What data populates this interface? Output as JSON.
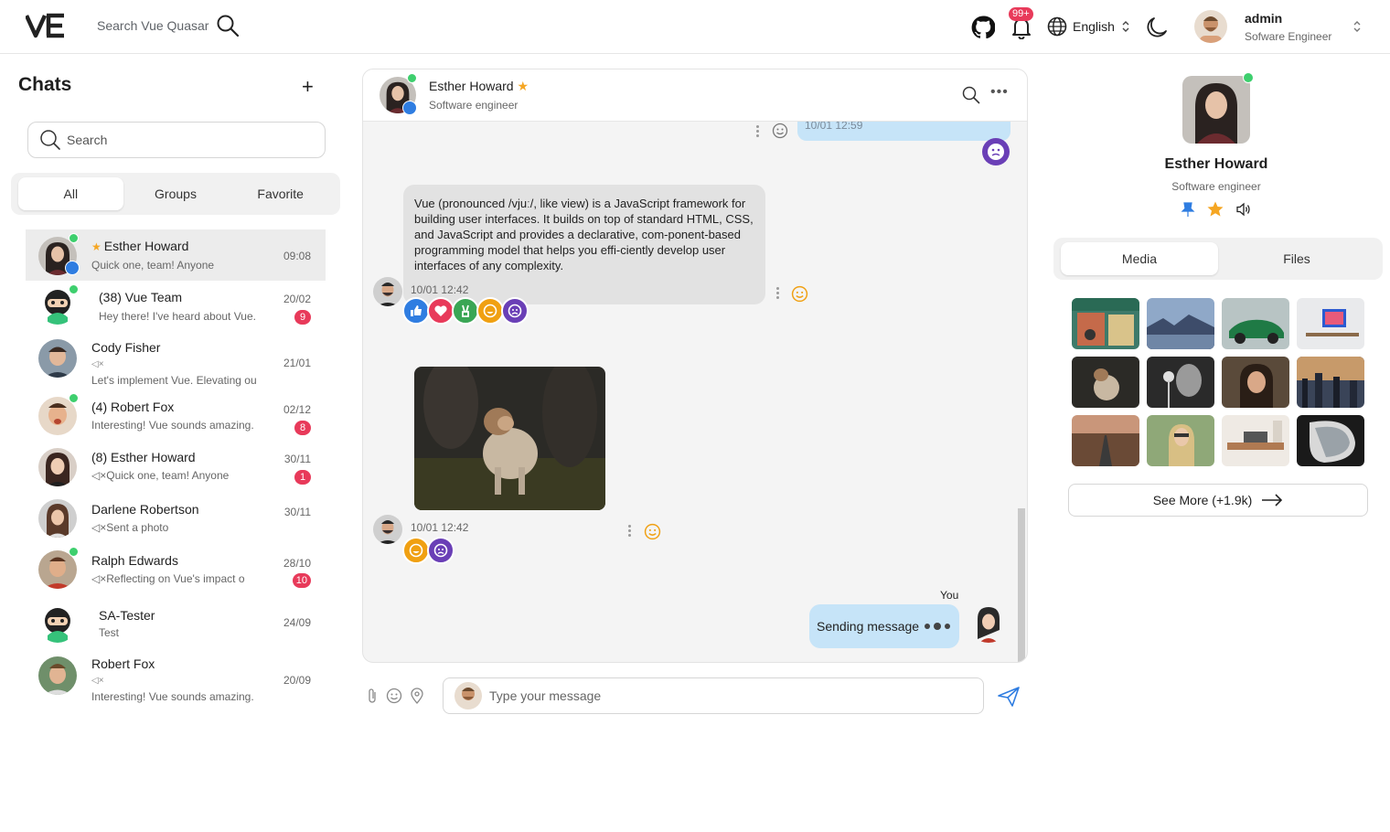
{
  "header": {
    "logo_text": "VE",
    "search_label": "Search Vue Quasar",
    "notifications_badge": "99+",
    "language": "English",
    "user_name": "admin",
    "user_role": "Sofware Engineer"
  },
  "sidebar": {
    "title": "Chats",
    "search_placeholder": "Search",
    "filters": [
      "All",
      "Groups",
      "Favorite"
    ],
    "active_filter": "All",
    "chats": [
      {
        "name": "Esther Howard",
        "favorite": true,
        "last": "Quick one, team! Anyone",
        "time": "09:08",
        "online": true,
        "pinned": true,
        "active": true
      },
      {
        "name": "(38) Vue Team",
        "last": "Hey there! I've heard about Vue.",
        "time": "20/02",
        "badge": "9",
        "online": true
      },
      {
        "name": "Cody Fisher",
        "muted": "◁×",
        "last": "Let's implement Vue. Elevating ou",
        "time": "21/01"
      },
      {
        "name": "(4) Robert Fox",
        "last": "Interesting! Vue sounds amazing.",
        "time": "02/12",
        "badge": "8",
        "online": true
      },
      {
        "name": "(8) Esther Howard",
        "last": "◁×Quick one, team! Anyone",
        "time": "30/11",
        "badge": "1"
      },
      {
        "name": "Darlene Robertson",
        "last": "◁×Sent a photo",
        "time": "30/11"
      },
      {
        "name": "Ralph Edwards",
        "last": "◁×Reflecting on Vue's impact o",
        "time": "28/10",
        "badge": "10",
        "online": true
      },
      {
        "name": "SA-Tester",
        "last": "Test",
        "time": "24/09"
      },
      {
        "name": "Robert Fox",
        "muted": "◁×",
        "last": "Interesting! Vue sounds amazing.",
        "time": "20/09"
      }
    ]
  },
  "conversation": {
    "contact_name": "Esther Howard",
    "contact_role": "Software engineer",
    "top_time": "10/01 12:59",
    "message_text": "Vue (pronounced /vjuː/, like view) is a JavaScript framework for building user interfaces. It builds on top of standard HTML, CSS, and JavaScript and provides a declarative, com-ponent-based programming model that helps you effi-ciently develop user interfaces of any complexity.",
    "message_time": "10/01 12:42",
    "photo_time": "10/01 12:42",
    "you_label": "You",
    "sending_text": "Sending message",
    "composer_placeholder": "Type your message"
  },
  "profile": {
    "name": "Esther Howard",
    "role": "Software engineer",
    "tabs": [
      "Media",
      "Files"
    ],
    "active_tab": "Media",
    "see_more": "See More (+1.9k)"
  },
  "colors": {
    "accent_blue": "#2f7de1",
    "online": "#3ecf6e",
    "badge": "#e83a5a",
    "bubble_own": "#c6e4f8",
    "bubble_other": "#e2e2e2",
    "star": "#f5a623"
  }
}
